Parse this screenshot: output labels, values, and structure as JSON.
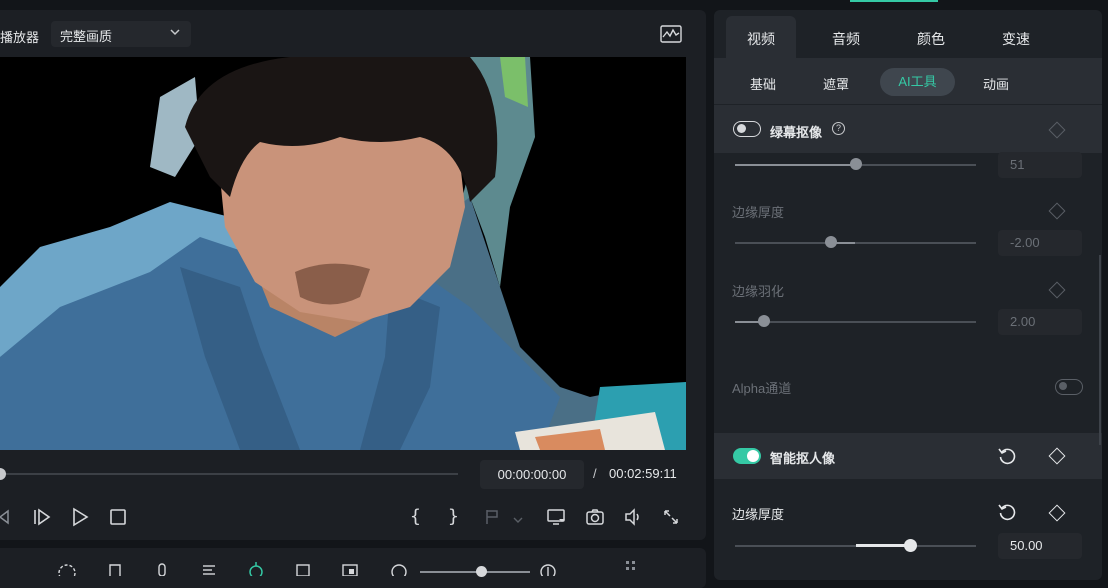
{
  "player": {
    "title": "播放器",
    "quality": "完整画质",
    "current_time": "00:00:00:00",
    "time_separator": "/",
    "total_time": "00:02:59:11",
    "playback_progress": 0
  },
  "properties": {
    "tabs": [
      "视频",
      "音频",
      "颜色",
      "变速"
    ],
    "active_tab": "视频",
    "subtabs": [
      "基础",
      "遮罩",
      "AI工具",
      "动画"
    ],
    "active_subtab": "AI工具",
    "green_screen": {
      "label": "绿幕抠像",
      "help": "?",
      "enabled": false,
      "slider1_value": "51",
      "slider1_level": 0.5,
      "edge_thickness_label": "边缘厚度",
      "edge_thickness_value": "-2.00",
      "edge_thickness_level": 0.4,
      "edge_feather_label": "边缘羽化",
      "edge_feather_value": "2.00",
      "edge_feather_level": 0.12,
      "alpha_label": "Alpha通道",
      "alpha_enabled": false
    },
    "smart_cutout": {
      "label": "智能抠人像",
      "enabled": true,
      "edge_thickness_label": "边缘厚度",
      "edge_thickness_value": "50.00",
      "edge_thickness_level": 0.73
    }
  },
  "colors": {
    "accent": "#35c9a5",
    "panel": "#1e2227",
    "background": "#121519"
  }
}
